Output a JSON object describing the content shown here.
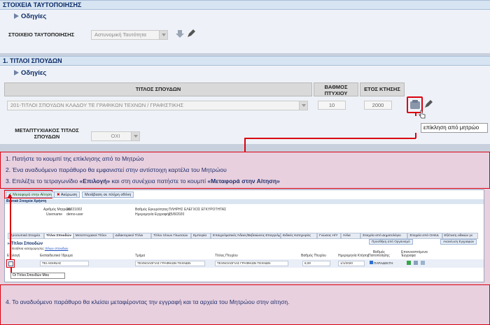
{
  "section1": {
    "title": "ΣΤΟΙΧΕΙΑ ΤΑΥΤΟΠΟΙΗΣΗΣ",
    "odigies": "Οδηγίες",
    "id_label": "ΣΤΟΙΧΕΙΟ ΤΑΥΤΟΠΟΙΗΣΗΣ",
    "id_value": "Αστυνομική Ταυτότητα"
  },
  "section2": {
    "title": "1. ΤΙΤΛΟΙ ΣΠΟΥΔΩΝ",
    "odigies": "Οδηγίες",
    "col_title": "ΤΙΤΛΟΣ ΣΠΟΥΔΩΝ",
    "col_grade_1": "ΒΑΘΜΟΣ",
    "col_grade_2": "ΠΤΥΧΙΟΥ",
    "col_year": "ΕΤΟΣ ΚΤΗΣΗΣ",
    "title_value": "201-ΤΙΤΛΟΙ ΣΠΟΥΔΩΝ ΚΛΑΔΟΥ ΤΕ ΓΡΑΦΙΚΩΝ ΤΕΧΝΩΝ / ΓΡΑΦΙΣΤΙΚΗΣ",
    "grade_value": "10",
    "year_value": "2000",
    "master_label_1": "ΜΕΤΑΠΤΥΧΙΑΚΟΣ ΤΙΤΛΟΣ",
    "master_label_2": "ΣΠΟΥΔΩΝ",
    "master_value": "ΟΧΙ",
    "tooltip": "επίκληση από μητρώο"
  },
  "steps": {
    "s1": "1.   Πατήστε το κουμπί της επίκλησης από το Μητρώο",
    "s2": "2.   Ένα αναδυόμενο παράθυρο θα εμφανιστεί στην αντίστοιχη καρτέλα του Μητρώου",
    "s3_a": "3.   Επιλέξτε το τετραγωνίδιο ",
    "s3_b": "«Επιλογή»",
    "s3_c": " και στη συνέχεια πατήστε το κουμπί ",
    "s3_d": "«Μεταφορά στην Αίτηση»",
    "s4": "4. Το αναδυόμενο παράθυρο θα κλείσει μεταφέροντας την εγγραφή και τα αρχεία του Μητρώου στην αίτηση."
  },
  "popup": {
    "btn_transfer": "Μεταφορά στην Αίτηση",
    "btn_cancel": "Ακύρωση",
    "btn_fullscreen": "Μετάβαση σε πλήρη οθόνη",
    "basic_title": "Βασικά Στοιχεία Χρήστη",
    "reg_no_label": "Αριθμός Μητρώου",
    "reg_no": "00721002",
    "username_label": "Username",
    "username": "demo-user",
    "degree_label": "Βαθμός Εγκυρότητας",
    "degree": "ΠΛΗΡΗΣ ΕΛΕΓΧΟΣ ΕΓΚΥΡΟΤΗΤΑΣ",
    "date_label": "Ημερομηνία Εγγραφής",
    "date": "25/8/2020",
    "tabs": [
      "Προσωπικά Στοιχεία",
      "Τίτλοι Σπουδών",
      "Μεταπτυχιακοί Τίτλοι",
      "Διδακτορικοί Τίτλοι",
      "Τίτλοι Ξένων Γλωσσών",
      "Εμπειρία",
      "Επαγγελματικές Άδειες/Βεβαιώσεις Επαγγελματικών Ενώσεων",
      "Ειδικές Κατηγορίες",
      "Γνώσεις Η/Υ",
      "Άλλα",
      "Στοιχεία από Δημοτολόγιο",
      "Στοιχεία από ΟΑΕΔ",
      "Εξέταση ειδικών γν"
    ],
    "section_title": "Τίτλοι Σπουδών",
    "instructions": "Βοήθεια καταχώρησης",
    "instructions_link": "τίτλων σπουδών",
    "btn_add": "Προσθήκη από Οργανισμό",
    "btn_refresh": "Ανανέωση Εγγραφών",
    "col_select": "Επιλογή",
    "col_inst": "Εκπαιδευτικό Ίδρυμα",
    "col_dept": "Τμήμα",
    "col_degree_title": "Τίτλος Πτυχίου",
    "col_grade": "Βαθμός Πτυχίου",
    "col_date": "Ημερομηνία Κτήσης",
    "col_cert_1": "Βαθμός",
    "col_cert_2": "Πιστοποίησης",
    "col_attach_1": "Επισυναπτόμενα",
    "col_attach_2": "Έγγραφα",
    "row_inst": "ΤΕΙ ΑΘΗΝΑΣ",
    "row_dept": "ΤΕΧΝΟΛΟΓΙΑΣ ΓΡΑΦΙΚΩΝ ΤΕΧΝΩΝ",
    "row_title": "ΤΕΧΝΟΛΟΓΙΑΣ ΓΡΑΦΙΚΩΝ ΤΕΧΝΩΝ",
    "row_grade": "8,00",
    "row_date": "1/1/2020",
    "row_cert": "ΠΑΡΑΔΕΚΤΗ",
    "footer": "Οι Τίτλοι Σπουδών Μου"
  },
  "colors": {
    "red": "#d9000f",
    "navy": "#0a2a66",
    "pink": "#e8d0df",
    "green": "#1f8b2b"
  }
}
